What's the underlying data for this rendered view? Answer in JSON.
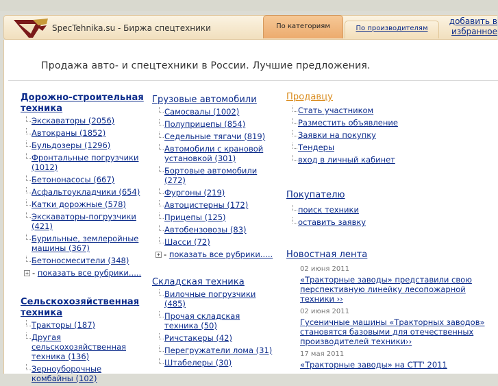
{
  "header": {
    "site_title": "SpecTehnika.su - Биржа спецтехники",
    "tab_categories": "По категориям",
    "tab_manufacturers": "По производителям",
    "favorites_line1": "добавить в",
    "favorites_line2": "избранное"
  },
  "slogan": "Продажа авто- и спецтехники в России. Лучшие предложения.",
  "col1": {
    "road": {
      "title": "Дорожно-строительная техника",
      "items": [
        {
          "label": "Экскаваторы",
          "count": "(2056)"
        },
        {
          "label": "Автокраны",
          "count": "(1852)"
        },
        {
          "label": "Бульдозеры",
          "count": "(1296)"
        },
        {
          "label": "Фронтальные погрузчики",
          "count": "(1012)"
        },
        {
          "label": "Бетононасосы",
          "count": "(667)"
        },
        {
          "label": "Асфальтоукладчики",
          "count": "(654)"
        },
        {
          "label": "Катки дорожные",
          "count": "(578)"
        },
        {
          "label": "Экскаваторы-погрузчики",
          "count": "(421)"
        },
        {
          "label": "Бурильные, землеройные машины",
          "count": "(367)"
        },
        {
          "label": "Бетоносмесители",
          "count": "(348)"
        }
      ],
      "show_all_prefix": "-",
      "show_all": "показать все рубрики....."
    },
    "agri": {
      "title": "Сельскохозяйственная техника",
      "items": [
        {
          "label": "Тракторы",
          "count": "(187)"
        },
        {
          "label": "Другая сельскохозяйственная техника",
          "count": "(136)"
        },
        {
          "label": "Зерноуборочные комбайны",
          "count": "(102)"
        }
      ]
    }
  },
  "col2": {
    "trucks": {
      "title": "Грузовые автомобили",
      "items": [
        {
          "label": "Самосвалы",
          "count": "(1002)"
        },
        {
          "label": "Полуприцепы",
          "count": "(854)"
        },
        {
          "label": "Седельные тягачи",
          "count": "(819)"
        },
        {
          "label": "Автомобили с крановой установкой",
          "count": "(301)"
        },
        {
          "label": "Бортовые автомобили",
          "count": "(272)"
        },
        {
          "label": "Фургоны",
          "count": "(219)"
        },
        {
          "label": "Автоцистерны",
          "count": "(172)"
        },
        {
          "label": "Прицепы",
          "count": "(125)"
        },
        {
          "label": "Автобензовозы",
          "count": "(83)"
        },
        {
          "label": "Шасси",
          "count": "(72)"
        }
      ],
      "show_all_prefix": "-",
      "show_all": "показать все рубрики....."
    },
    "warehouse": {
      "title": "Складская техника",
      "items": [
        {
          "label": "Вилочные погрузчики",
          "count": "(485)"
        },
        {
          "label": "Прочая складская техника",
          "count": "(50)"
        },
        {
          "label": "Ричстакеры",
          "count": "(42)"
        },
        {
          "label": "Перегружатели лома",
          "count": "(31)"
        },
        {
          "label": "Штабелеры",
          "count": "(30)"
        }
      ]
    }
  },
  "col3": {
    "seller": {
      "title": "Продавцу",
      "items": [
        "Стать участником",
        "Разместить объявление",
        "Заявки на покупку",
        "Тендеры",
        "вход в личный кабинет"
      ]
    },
    "buyer": {
      "title": "Покупателю",
      "items": [
        "поиск техники",
        "оставить заявку"
      ]
    },
    "news": {
      "title": "Новостная лента",
      "items": [
        {
          "date": "02 июня 2011",
          "text": "«Тракторные заводы» представили свою перспективную линейку лесопожарной техники ››"
        },
        {
          "date": "02 июня 2011",
          "text": "Гусеничные машины «Тракторных заводов» становятся базовыми для отечественных производителей техники››"
        },
        {
          "date": "17 мая 2011",
          "text": "«Тракторные заводы» на СТТ' 2011"
        }
      ]
    }
  },
  "colors": {
    "link": "#0a2a8a",
    "seller_title": "#d98b1c",
    "active_tab": "#ecab6e",
    "header_bg": "#f1dfbd"
  }
}
